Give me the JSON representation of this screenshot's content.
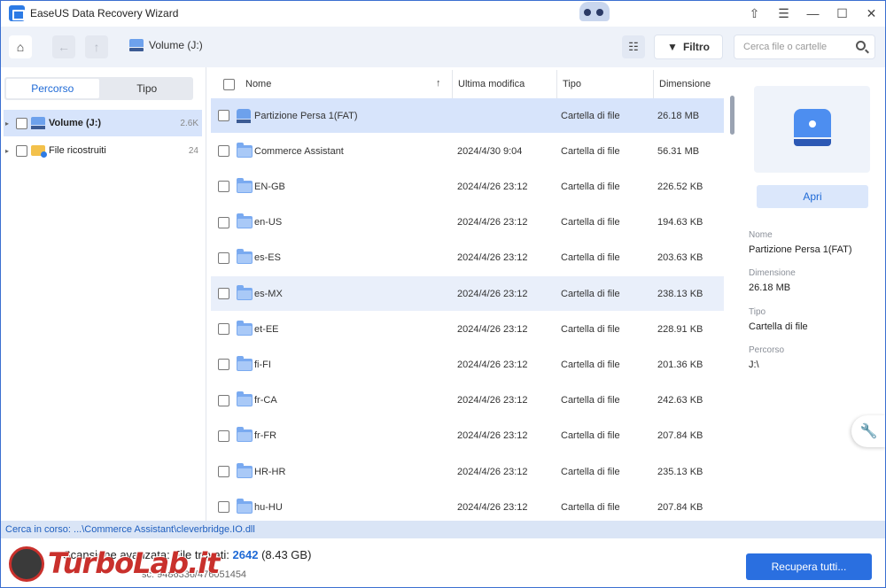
{
  "window": {
    "title": "EaseUS Data Recovery Wizard",
    "controls": [
      "⇧",
      "☰",
      "—",
      "☐",
      "✕"
    ]
  },
  "toolbar": {
    "home_icon": "⌂",
    "back_icon": "←",
    "up_icon": "↑",
    "breadcrumb": "Volume (J:)",
    "list_view_icon": "☷",
    "filter_label": "Filtro",
    "search_placeholder": "Cerca file o cartelle"
  },
  "left_pane": {
    "tabs": [
      {
        "label": "Percorso",
        "active": true
      },
      {
        "label": "Tipo",
        "active": false
      }
    ],
    "tree": [
      {
        "label": "Volume (J:)",
        "count": "2.6K",
        "icon": "drive-icon",
        "selected": true
      },
      {
        "label": "File ricostruiti",
        "count": "24",
        "icon": "folder-lock-icon",
        "selected": false
      }
    ]
  },
  "list": {
    "columns": {
      "name": "Nome",
      "modified": "Ultima modifica",
      "type": "Tipo",
      "size": "Dimensione"
    },
    "rows": [
      {
        "name": "Partizione Persa 1(FAT)",
        "modified": "",
        "type": "Cartella di file",
        "size": "26.18 MB",
        "icon": "partition-icon",
        "state": "selected"
      },
      {
        "name": "Commerce Assistant",
        "modified": "2024/4/30 9:04",
        "type": "Cartella di file",
        "size": "56.31 MB",
        "icon": "folder-icon",
        "state": ""
      },
      {
        "name": "EN-GB",
        "modified": "2024/4/26 23:12",
        "type": "Cartella di file",
        "size": "226.52 KB",
        "icon": "folder-icon",
        "state": ""
      },
      {
        "name": "en-US",
        "modified": "2024/4/26 23:12",
        "type": "Cartella di file",
        "size": "194.63 KB",
        "icon": "folder-icon",
        "state": ""
      },
      {
        "name": "es-ES",
        "modified": "2024/4/26 23:12",
        "type": "Cartella di file",
        "size": "203.63 KB",
        "icon": "folder-icon",
        "state": ""
      },
      {
        "name": "es-MX",
        "modified": "2024/4/26 23:12",
        "type": "Cartella di file",
        "size": "238.13 KB",
        "icon": "folder-icon",
        "state": "hover"
      },
      {
        "name": "et-EE",
        "modified": "2024/4/26 23:12",
        "type": "Cartella di file",
        "size": "228.91 KB",
        "icon": "folder-icon",
        "state": ""
      },
      {
        "name": "fi-FI",
        "modified": "2024/4/26 23:12",
        "type": "Cartella di file",
        "size": "201.36 KB",
        "icon": "folder-icon",
        "state": ""
      },
      {
        "name": "fr-CA",
        "modified": "2024/4/26 23:12",
        "type": "Cartella di file",
        "size": "242.63 KB",
        "icon": "folder-icon",
        "state": ""
      },
      {
        "name": "fr-FR",
        "modified": "2024/4/26 23:12",
        "type": "Cartella di file",
        "size": "207.84 KB",
        "icon": "folder-icon",
        "state": ""
      },
      {
        "name": "HR-HR",
        "modified": "2024/4/26 23:12",
        "type": "Cartella di file",
        "size": "235.13 KB",
        "icon": "folder-icon",
        "state": ""
      },
      {
        "name": "hu-HU",
        "modified": "2024/4/26 23:12",
        "type": "Cartella di file",
        "size": "207.84 KB",
        "icon": "folder-icon",
        "state": ""
      }
    ]
  },
  "preview": {
    "open_label": "Apri",
    "name_label": "Nome",
    "name_value": "Partizione Persa 1(FAT)",
    "size_label": "Dimensione",
    "size_value": "26.18 MB",
    "type_label": "Tipo",
    "type_value": "Cartella di file",
    "path_label": "Percorso",
    "path_value": "J:\\"
  },
  "status": {
    "searching": "Cerca in corso: ...\\Commerce Assistant\\cleverbridge.IO.dll"
  },
  "footer": {
    "scan_prefix": "Scansione avanzata: File trovati:",
    "found_count": "2642",
    "found_size": "(8.43 GB)",
    "sectors": "sc: 9486336/476051454",
    "recover_label": "Recupera tutti..."
  },
  "watermark": {
    "text": "TurboLab.it"
  },
  "colors": {
    "accent": "#2a6fe0",
    "selection": "#d7e4fb",
    "status_bg": "#dae5f6"
  }
}
